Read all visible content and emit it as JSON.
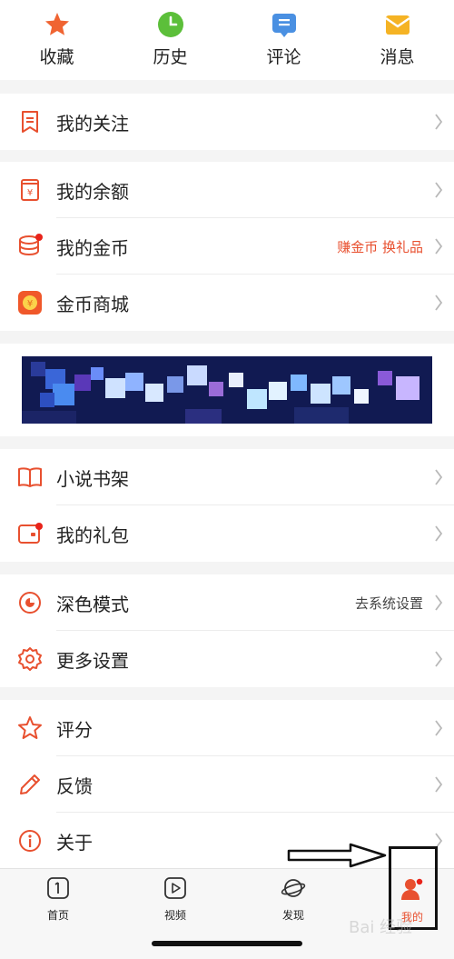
{
  "colors": {
    "accent": "#e8502f",
    "text": "#222222",
    "muted": "#b8b8b8"
  },
  "quick": [
    {
      "label": "收藏",
      "icon": "star-icon"
    },
    {
      "label": "历史",
      "icon": "clock-icon"
    },
    {
      "label": "评论",
      "icon": "comment-icon"
    },
    {
      "label": "消息",
      "icon": "envelope-icon"
    }
  ],
  "menu": {
    "follow": "我的关注",
    "balance": "我的余额",
    "coins": "我的金币",
    "coins_right": "赚金币 换礼品",
    "coin_mall": "金币商城",
    "bookshelf": "小说书架",
    "gift": "我的礼包",
    "dark_mode": "深色模式",
    "dark_mode_right": "去系统设置",
    "more_settings": "更多设置",
    "rate": "评分",
    "feedback": "反馈",
    "about": "关于"
  },
  "tabs": [
    {
      "label": "首页",
      "icon": "home-icon"
    },
    {
      "label": "视频",
      "icon": "video-icon"
    },
    {
      "label": "发现",
      "icon": "planet-icon"
    },
    {
      "label": "我的",
      "icon": "profile-icon",
      "active": true
    }
  ],
  "watermark": "Bai 经验"
}
